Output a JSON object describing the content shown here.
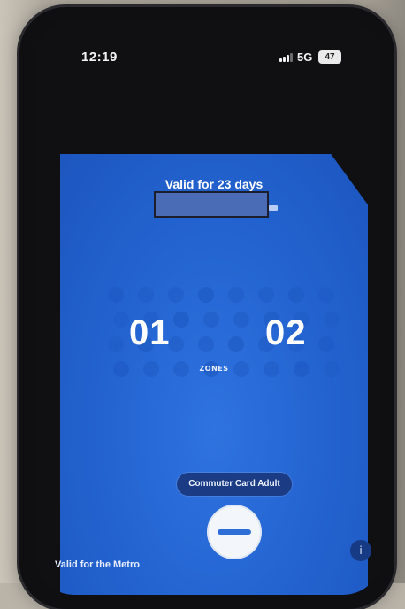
{
  "status_bar": {
    "time": "12:19",
    "network": "5G",
    "battery": "47"
  },
  "ticket": {
    "validity": "Valid for 23 days",
    "zone_from": "01",
    "zone_to": "02",
    "zones_label": "ZONES",
    "product": "Commuter Card Adult",
    "badge_top": "",
    "badge_bottom": "",
    "valid_for": "Valid for the Metro"
  },
  "icons": {
    "info": "info-icon",
    "signal": "cellular-signal-icon",
    "battery": "battery-icon"
  },
  "colors": {
    "ticket_blue": "#2465d2",
    "pill_dark_blue": "#1b3c84",
    "badge_bg": "#f3f6fb"
  }
}
